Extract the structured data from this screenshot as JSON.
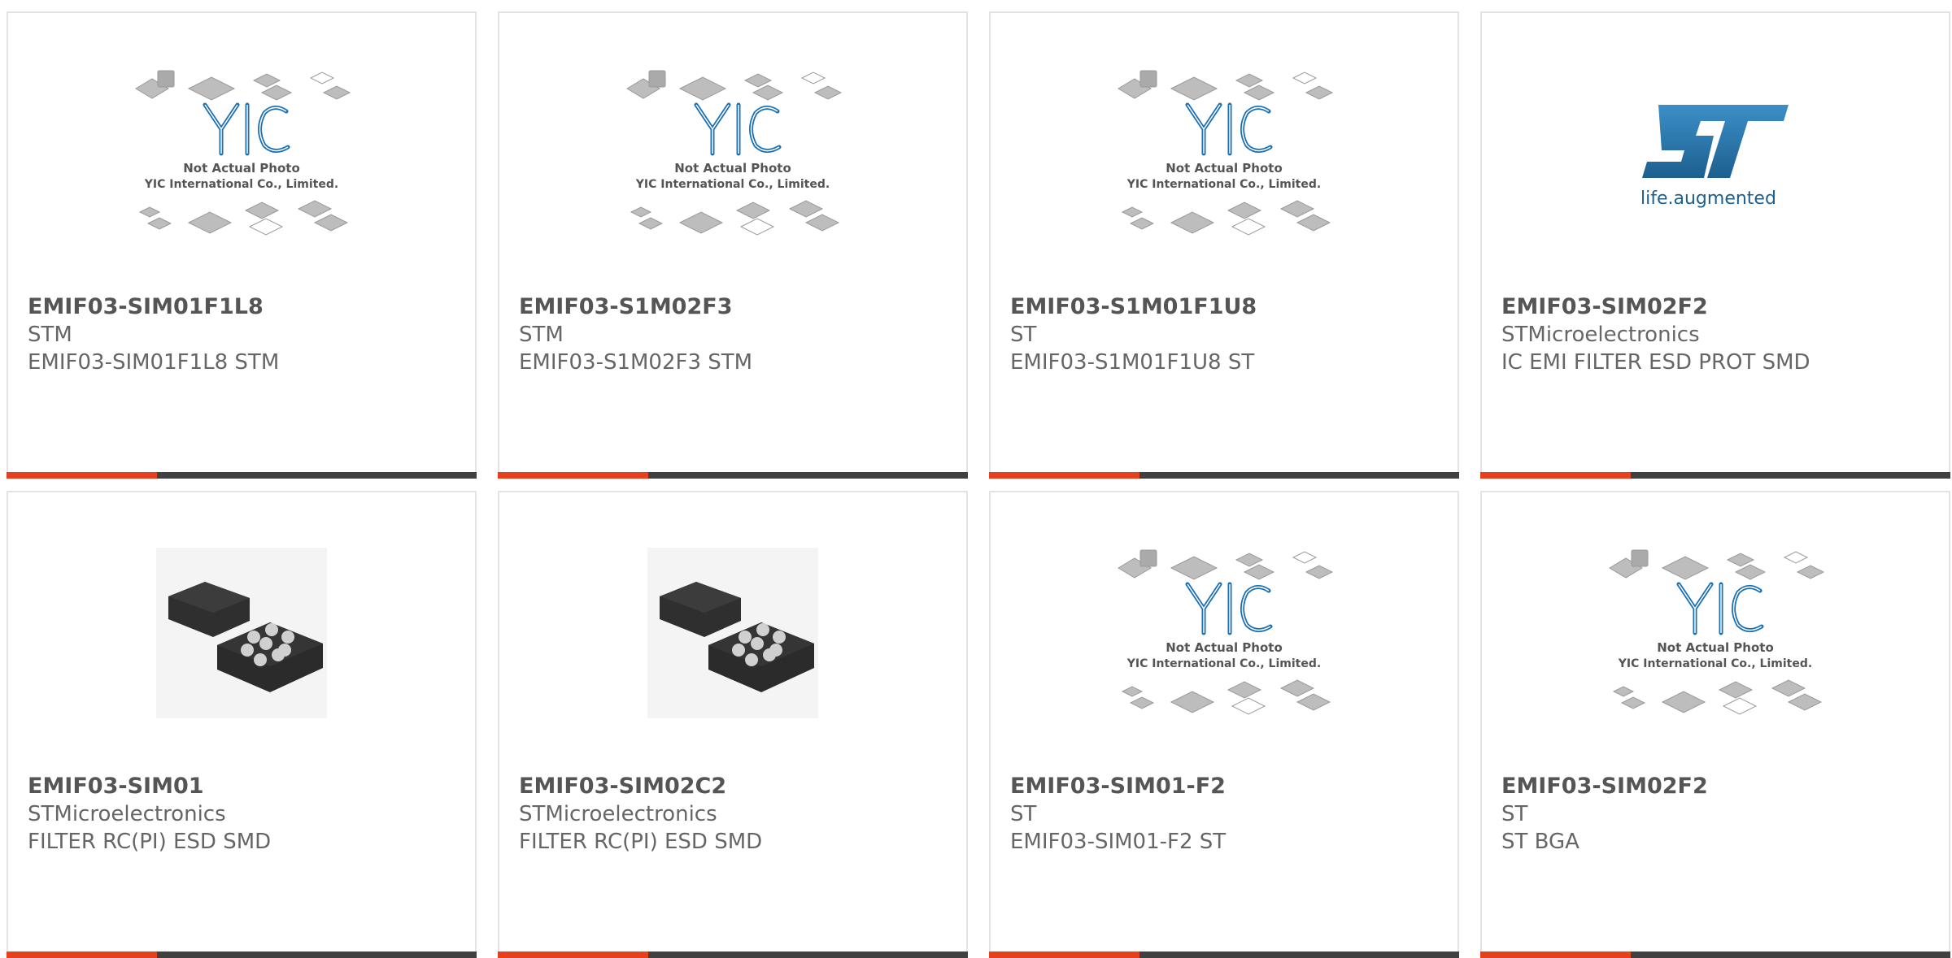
{
  "photo_caption": {
    "line1": "Not Actual Photo",
    "line2": "YIC International Co., Limited."
  },
  "st_logo_tagline": "life.augmented",
  "accent_color": "#e8401c",
  "bar_color": "#404040",
  "products": [
    {
      "part_number": "EMIF03-SIM01F1L8",
      "manufacturer": "STM",
      "description": "EMIF03-SIM01F1L8 STM",
      "image": "yic-placeholder-photo"
    },
    {
      "part_number": "EMIF03-S1M02F3",
      "manufacturer": "STM",
      "description": "EMIF03-S1M02F3 STM",
      "image": "yic-placeholder-photo"
    },
    {
      "part_number": "EMIF03-S1M01F1U8",
      "manufacturer": "ST",
      "description": "EMIF03-S1M01F1U8 ST",
      "image": "yic-placeholder-photo"
    },
    {
      "part_number": "EMIF03-SIM02F2",
      "manufacturer": "STMicroelectronics",
      "description": "IC EMI FILTER ESD PROT SMD",
      "image": "st-logo"
    },
    {
      "part_number": "EMIF03-SIM01",
      "manufacturer": "STMicroelectronics",
      "description": "FILTER RC(PI) ESD SMD",
      "image": "bga-chip-photo"
    },
    {
      "part_number": "EMIF03-SIM02C2",
      "manufacturer": "STMicroelectronics",
      "description": "FILTER RC(PI) ESD SMD",
      "image": "bga-chip-photo"
    },
    {
      "part_number": "EMIF03-SIM01-F2",
      "manufacturer": "ST",
      "description": "EMIF03-SIM01-F2 ST",
      "image": "yic-placeholder-photo"
    },
    {
      "part_number": "EMIF03-SIM02F2",
      "manufacturer": "ST",
      "description": "ST BGA",
      "image": "yic-placeholder-photo"
    }
  ]
}
